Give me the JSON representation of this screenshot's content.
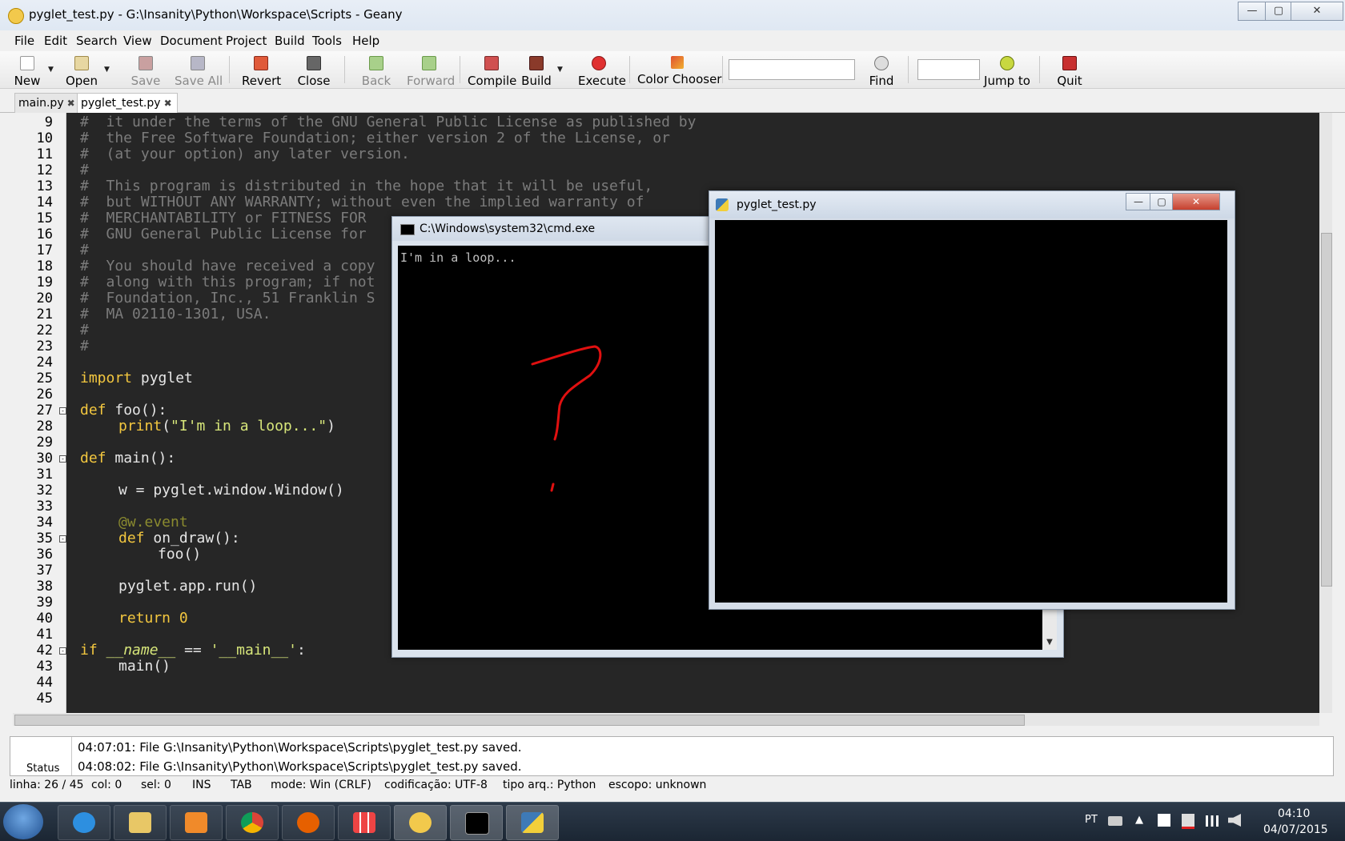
{
  "window": {
    "title": "pyglet_test.py - G:\\Insanity\\Python\\Workspace\\Scripts - Geany",
    "min": "—",
    "max": "▢",
    "close": "✕"
  },
  "menu": [
    "File",
    "Edit",
    "Search",
    "View",
    "Document",
    "Project",
    "Build",
    "Tools",
    "Help"
  ],
  "toolbar": {
    "new": "New",
    "open": "Open",
    "save": "Save",
    "save_all": "Save All",
    "revert": "Revert",
    "close": "Close",
    "back": "Back",
    "forward": "Forward",
    "compile": "Compile",
    "build": "Build",
    "execute": "Execute",
    "color_chooser": "Color Chooser",
    "search_value": "",
    "find": "Find",
    "goto_value": "",
    "jump_to": "Jump to",
    "quit": "Quit",
    "arrow": "▼"
  },
  "tabs": [
    {
      "label": "main.py",
      "close": "✖"
    },
    {
      "label": "pyglet_test.py",
      "close": "✖"
    }
  ],
  "editor": {
    "line_numbers": [
      "9",
      "10",
      "11",
      "12",
      "13",
      "14",
      "15",
      "16",
      "17",
      "18",
      "19",
      "20",
      "21",
      "22",
      "23",
      "24",
      "25",
      "26",
      "27",
      "28",
      "29",
      "30",
      "31",
      "32",
      "33",
      "34",
      "35",
      "36",
      "37",
      "38",
      "39",
      "40",
      "41",
      "42",
      "43",
      "44",
      "45"
    ],
    "comment_lines": [
      "#  it under the terms of the GNU General Public License as published by",
      "#  the Free Software Foundation; either version 2 of the License, or",
      "#  (at your option) any later version.",
      "#",
      "#  This program is distributed in the hope that it will be useful,",
      "#  but WITHOUT ANY WARRANTY; without even the implied warranty of",
      "#  MERCHANTABILITY or FITNESS FOR",
      "#  GNU General Public License for",
      "#",
      "#  You should have received a copy",
      "#  along with this program; if not",
      "#  Foundation, Inc., 51 Franklin S",
      "#  MA 02110-1301, USA.",
      "#",
      "#"
    ],
    "code": {
      "import_kw": "import",
      "import_rest": " pyglet",
      "def1_kw": "def",
      "def1_rest": " foo():",
      "print_kw": "print",
      "print_open": "(",
      "print_str": "\"I'm in a loop...\"",
      "print_close": ")",
      "def2_kw": "def",
      "def2_rest": " main():",
      "window_line": "w = pyglet.window.Window()",
      "decorator": "@w.event",
      "def3_kw": "def",
      "def3_rest": " on_draw():",
      "foo_call": "foo()",
      "run_line": "pyglet.app.run()",
      "return_kw": "return",
      "return_val": " 0",
      "if_kw": "if",
      "if_name": " __name__",
      "if_eq": " == ",
      "if_str": "'__main__'",
      "if_colon": ":",
      "main_call": "main()"
    },
    "fold_marker": "-"
  },
  "messages": [
    "04:07:01: File G:\\Insanity\\Python\\Workspace\\Scripts\\pyglet_test.py saved.",
    "04:08:02: File G:\\Insanity\\Python\\Workspace\\Scripts\\pyglet_test.py saved."
  ],
  "message_tab": "Status",
  "statusbar": {
    "line": "linha: 26 / 45",
    "col": "col: 0",
    "sel": "sel: 0",
    "ins": "INS",
    "tab": "TAB",
    "mode": "mode: Win (CRLF)",
    "encoding": "codificação: UTF-8",
    "filetype": "tipo arq.: Python",
    "scope": "escopo: unknown"
  },
  "cmd": {
    "title": "C:\\Windows\\system32\\cmd.exe",
    "output": "I'm in a loop...",
    "scroll_down": "▼"
  },
  "pyglet": {
    "title": "pyglet_test.py",
    "min": "—",
    "max": "▢",
    "close": "✕"
  },
  "taskbar": {
    "language": "PT",
    "time": "04:10",
    "date": "04/07/2015",
    "tray_up": "▲"
  },
  "colors": {
    "editor_bg": "#262626",
    "keyword": "#f3c73f",
    "string": "#d7e67a",
    "comment": "#7b7b7b",
    "annotation_red": "#e01010"
  }
}
